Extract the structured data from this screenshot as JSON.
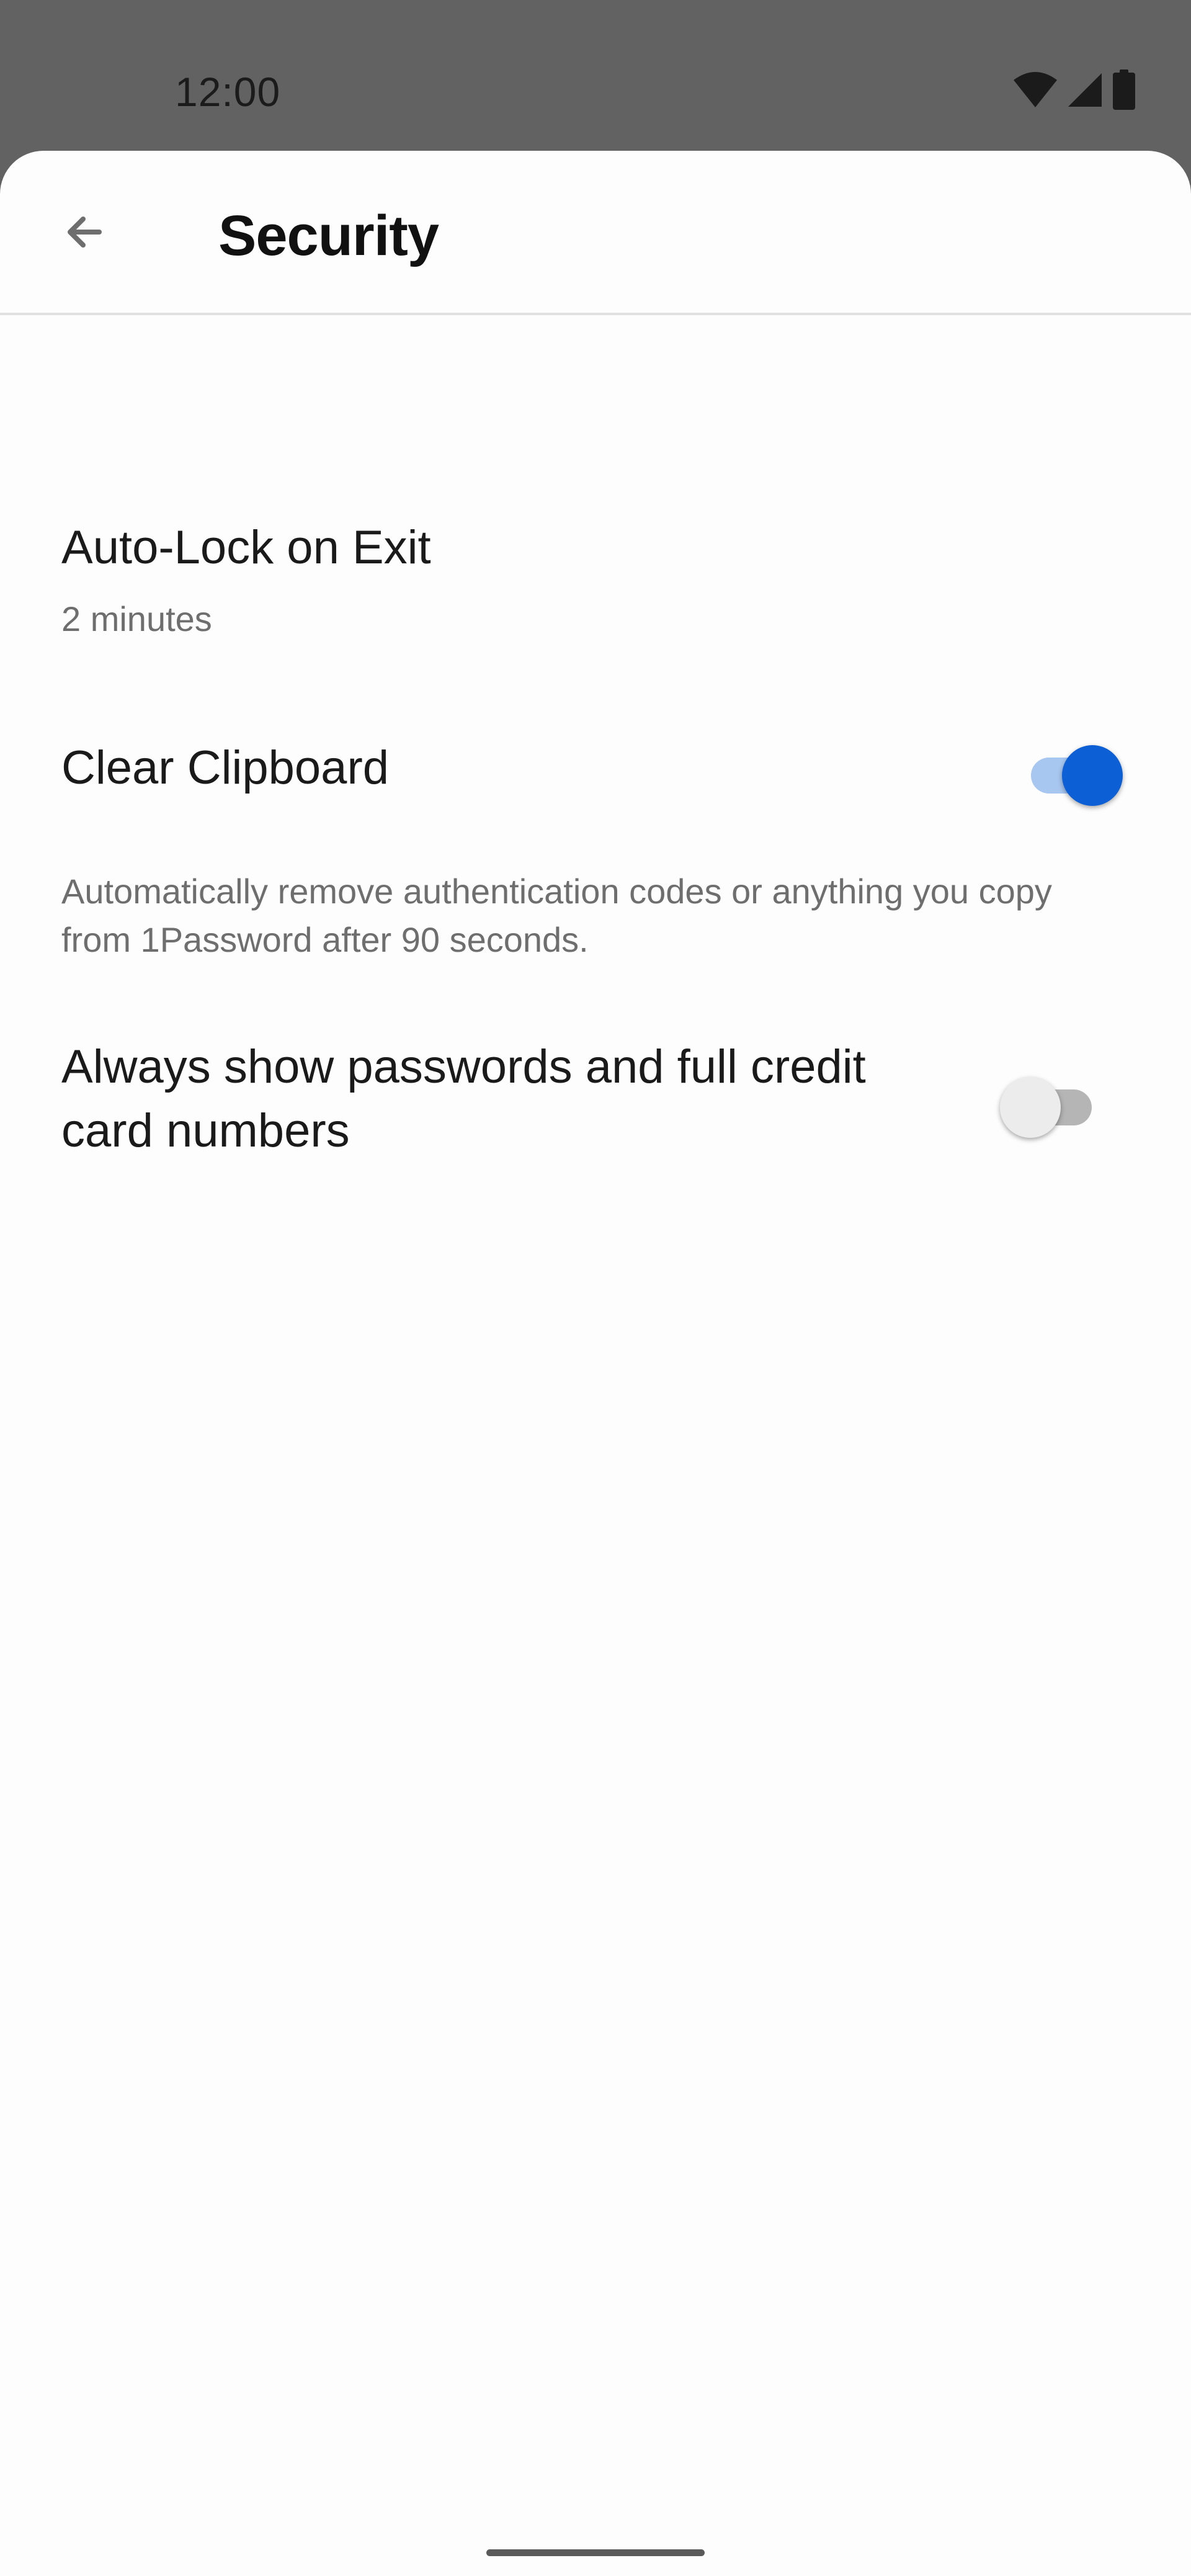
{
  "status_bar": {
    "time": "12:00",
    "icons": [
      "wifi-icon",
      "signal-icon",
      "battery-icon"
    ]
  },
  "app_bar": {
    "back_icon": "arrow-left-icon",
    "title": "Security"
  },
  "settings": {
    "auto_lock": {
      "title": "Auto-Lock on Exit",
      "value": "2 minutes"
    },
    "clear_clipboard": {
      "title": "Clear Clipboard",
      "enabled": true,
      "description": "Automatically remove authentication codes or anything you copy from 1Password after 90 seconds."
    },
    "always_show": {
      "title_line1": "Always show passwords and full credit",
      "title_line2": "card numbers",
      "enabled": false
    }
  },
  "colors": {
    "accent": "#0d5fd6",
    "accent_track": "#a8c7f0",
    "scrim": "#626262",
    "sheet": "#fdfdfd"
  }
}
